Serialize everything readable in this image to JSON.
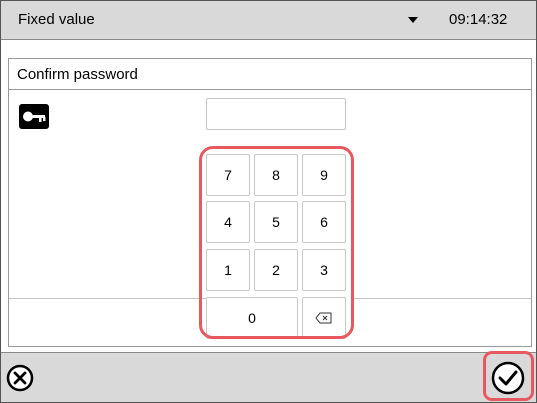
{
  "header": {
    "title": "Fixed value",
    "dropdown_icon": "caret-down-icon",
    "time": "09:14:32"
  },
  "dialog": {
    "title": "Confirm password",
    "key_icon": "key-icon",
    "password_value": "",
    "keypad": {
      "rows": [
        [
          "7",
          "8",
          "9"
        ],
        [
          "4",
          "5",
          "6"
        ],
        [
          "1",
          "2",
          "3"
        ]
      ],
      "zero": "0",
      "backspace_icon": "backspace-icon"
    }
  },
  "footer": {
    "cancel_icon": "cancel-circle-x-icon",
    "confirm_icon": "confirm-circle-check-icon"
  },
  "colors": {
    "bar_background": "#d9d9d9",
    "highlight": "#e8585f"
  }
}
